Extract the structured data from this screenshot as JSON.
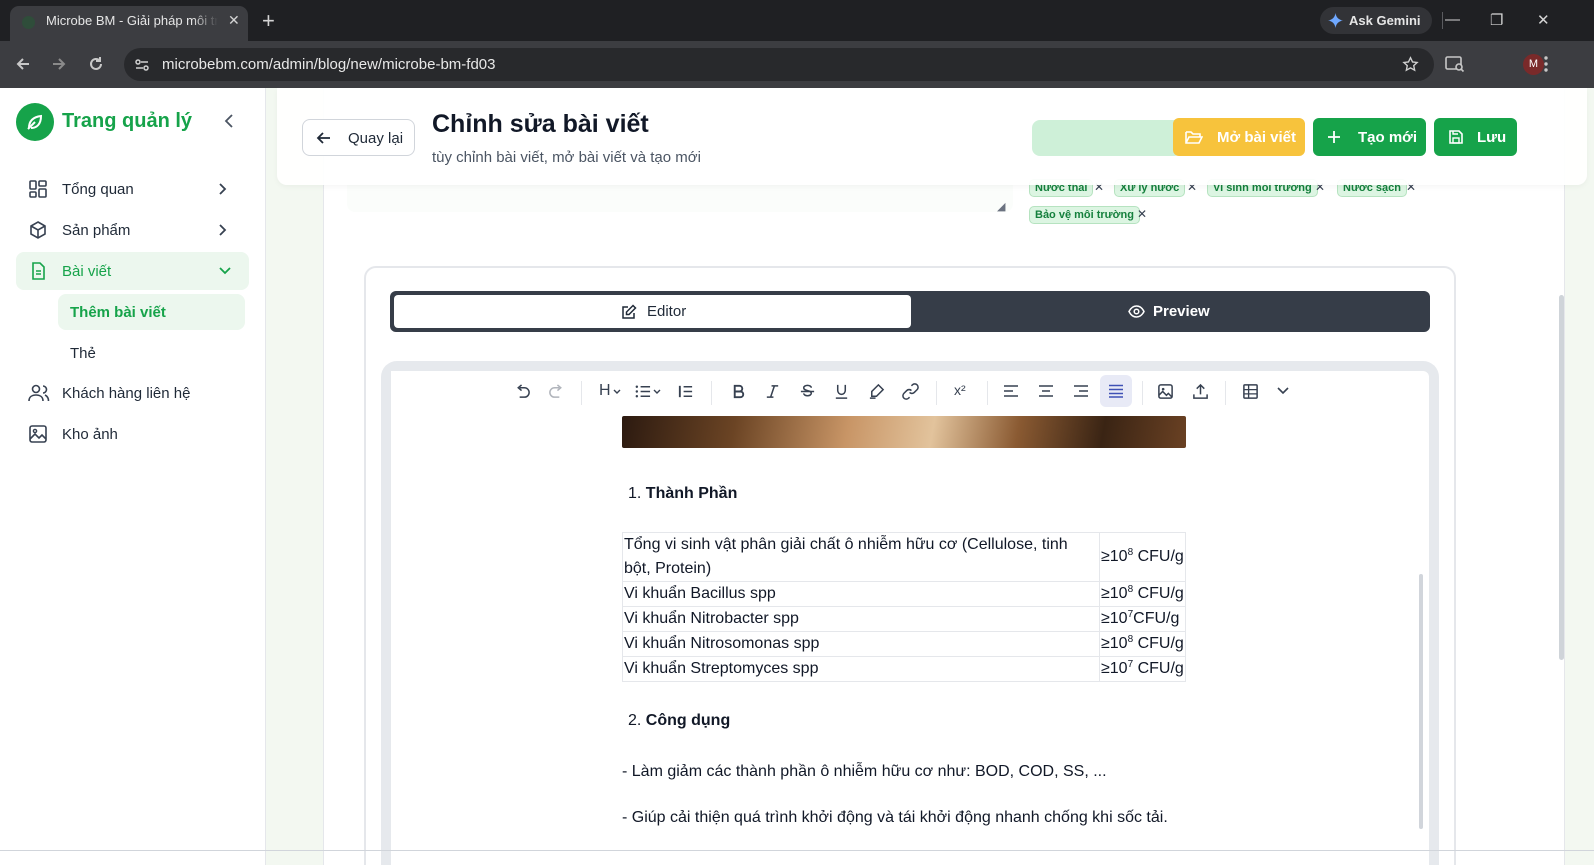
{
  "browser": {
    "tab_title": "Microbe BM - Giải pháp môi trường",
    "new_tab_symbol": "+",
    "tab_close_symbol": "✕",
    "ask_gemini": "Ask Gemini",
    "url": "microbebm.com/admin/blog/new/microbe-bm-fd03",
    "profile_initial": "M",
    "window_controls": {
      "minimize": "—",
      "restore": "❐",
      "close": "✕"
    }
  },
  "sidebar": {
    "brand": "Trang quản lý",
    "items": [
      {
        "label": "Tổng quan",
        "icon": "dashboard-icon",
        "expandable": true
      },
      {
        "label": "Sản phẩm",
        "icon": "box-icon",
        "expandable": true
      },
      {
        "label": "Bài viết",
        "icon": "document-icon",
        "expanded": true,
        "active": true
      },
      {
        "label": "Khách hàng liên hệ",
        "icon": "users-icon"
      },
      {
        "label": "Kho ảnh",
        "icon": "image-icon"
      }
    ],
    "sub_items": [
      {
        "label": "Thêm bài viết",
        "active": true
      },
      {
        "label": "Thẻ"
      }
    ]
  },
  "header": {
    "back_label": "Quay lại",
    "title": "Chỉnh sửa bài viết",
    "subtitle": "tùy chỉnh bài viết, mở bài viết và tạo mới",
    "actions": {
      "open_post": "Mở bài viết",
      "create_new": "Tạo mới",
      "save": "Lưu"
    }
  },
  "tags": {
    "items": [
      "Nước thải",
      "Xử lý nước",
      "Vi sinh môi trường",
      "Nước sạch",
      "Bảo vệ môi trường"
    ],
    "remove_symbol": "✕"
  },
  "mode_switch": {
    "editor": "Editor",
    "preview": "Preview",
    "selected": "Editor"
  },
  "toolbar": {
    "heading": "H",
    "superscript": "x²",
    "buttons": [
      "undo-icon",
      "redo-icon",
      "heading-icon",
      "bullet-list-icon",
      "blockquote-icon",
      "bold-icon",
      "italic-icon",
      "strikethrough-icon",
      "underline-icon",
      "highlight-icon",
      "link-icon",
      "superscript-icon",
      "align-left-icon",
      "align-center-icon",
      "align-right-icon",
      "align-justify-icon",
      "image-icon",
      "upload-icon",
      "table-icon",
      "chevron-down-icon"
    ],
    "active": "align-justify-icon"
  },
  "document": {
    "section1_num": "1.",
    "section1_title": "Thành Phần",
    "table": [
      {
        "name": "Tổng vi sinh vật phân giải chất ô nhiễm hữu cơ (Cellulose, tinh bột, Protein)",
        "base": "≥10",
        "exp": "8",
        "unit": " CFU/g"
      },
      {
        "name": "Vi khuẩn Bacillus spp",
        "base": "≥10",
        "exp": "8",
        "unit": " CFU/g"
      },
      {
        "name": "Vi khuẩn Nitrobacter spp",
        "base": "≥10",
        "exp": "7",
        "unit": "CFU/g"
      },
      {
        "name": "Vi khuẩn Nitrosomonas spp",
        "base": "≥10",
        "exp": "8",
        "unit": " CFU/g"
      },
      {
        "name": "Vi khuẩn Streptomyces spp",
        "base": "≥10",
        "exp": "7",
        "unit": " CFU/g"
      }
    ],
    "section2_num": "2.",
    "section2_title": "Công dụng",
    "paragraphs": [
      "- Làm giảm các thành phần ô nhiễm hữu cơ như: BOD, COD, SS, ...",
      "- Giúp cải thiện quá trình khởi động và tái khởi động nhanh chống khi sốc tải."
    ]
  },
  "colors": {
    "brand_green": "#16a34a",
    "accent_yellow": "#f7c33c",
    "segment_dark": "#363d48",
    "active_bg": "#ecf7ee"
  }
}
